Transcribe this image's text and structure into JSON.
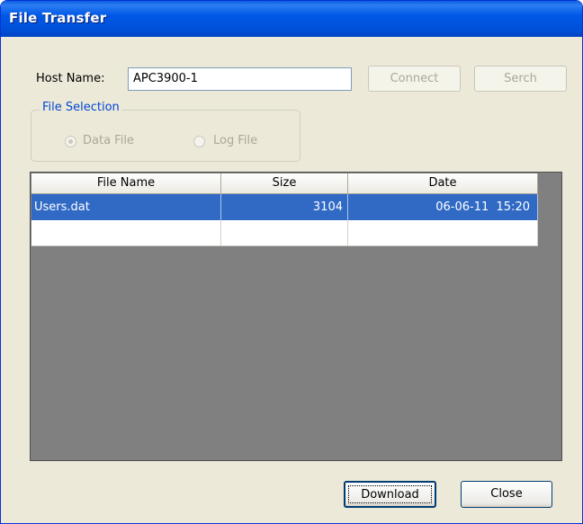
{
  "window": {
    "title": "File Transfer",
    "accent": "#0054e3"
  },
  "host": {
    "label": "Host Name:",
    "value": "APC3900-1"
  },
  "buttons": {
    "connect": "Connect",
    "search": "Serch",
    "download": "Download",
    "close": "Close"
  },
  "file_selection": {
    "title": "File Selection",
    "options": [
      {
        "label": "Data File",
        "selected": true,
        "enabled": false
      },
      {
        "label": "Log File",
        "selected": false,
        "enabled": false
      }
    ]
  },
  "table": {
    "columns": [
      "File Name",
      "Size",
      "Date"
    ],
    "rows": [
      {
        "name": "Users.dat",
        "size": "3104",
        "date": "06-06-11  15:20",
        "selected": true
      }
    ],
    "selection_color": "#316ac5"
  }
}
